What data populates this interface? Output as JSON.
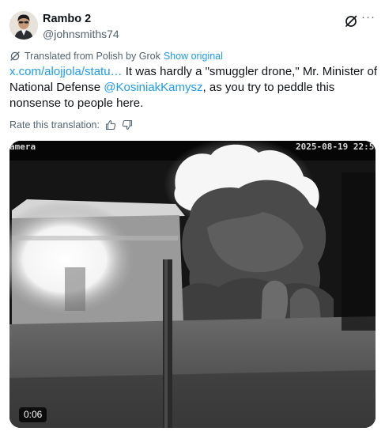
{
  "author": {
    "display_name": "Rambo 2",
    "handle": "@johnsmiths74"
  },
  "header": {
    "grok_icon": "grok-icon",
    "more_icon": "more-icon"
  },
  "translation": {
    "label": "Translated from Polish by Grok",
    "show_original": "Show original"
  },
  "tweet": {
    "link": "x.com/alojjola/statu…",
    "text_before_mention": " It was hardly a \"smuggler drone,\" Mr. Minister of National Defense ",
    "mention": "@KosiniakKamysz",
    "text_after_mention": ", as you try to peddle this nonsense to people here."
  },
  "rating": {
    "label": "Rate this translation:",
    "thumbs_up_icon": "thumbs-up-icon",
    "thumbs_down_icon": "thumbs-down-icon"
  },
  "video": {
    "overlay_label": "amera",
    "overlay_timestamp": "2025-08-19 22:5",
    "duration": "0:06"
  },
  "colors": {
    "link": "#1d9bf0",
    "secondary_text": "#536471",
    "primary_text": "#0f1419"
  }
}
